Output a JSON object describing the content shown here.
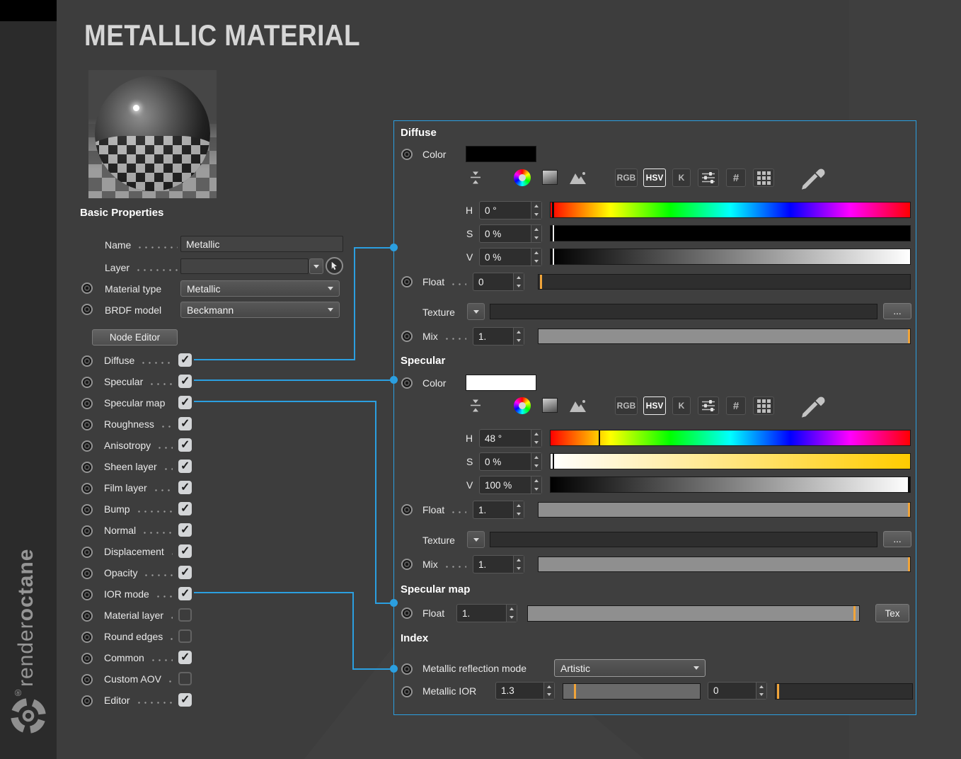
{
  "colors": {
    "accent_blue": "#2b9fe0",
    "slider_marker_orange": "#f0a43a",
    "diffuse_swatch": "#000000",
    "specular_swatch": "#ffffff"
  },
  "sidebar": {
    "brand_bold": "octane",
    "brand_light": "render",
    "registered": "®"
  },
  "header": {
    "title": "METALLIC MATERIAL"
  },
  "basic": {
    "heading": "Basic Properties",
    "name_label": "Name",
    "name_value": "Metallic",
    "layer_label": "Layer",
    "layer_value": "",
    "material_type_label": "Material type",
    "material_type_value": "Metallic",
    "brdf_label": "BRDF model",
    "brdf_value": "Beckmann",
    "node_editor": "Node Editor",
    "toggles": [
      {
        "label": "Diffuse",
        "checked": true
      },
      {
        "label": "Specular",
        "checked": true
      },
      {
        "label": "Specular map",
        "checked": true
      },
      {
        "label": "Roughness",
        "checked": true
      },
      {
        "label": "Anisotropy",
        "checked": true
      },
      {
        "label": "Sheen layer",
        "checked": true
      },
      {
        "label": "Film layer",
        "checked": true
      },
      {
        "label": "Bump",
        "checked": true
      },
      {
        "label": "Normal",
        "checked": true
      },
      {
        "label": "Displacement",
        "checked": true
      },
      {
        "label": "Opacity",
        "checked": true
      },
      {
        "label": "IOR mode",
        "checked": true
      },
      {
        "label": "Material layer",
        "checked": false
      },
      {
        "label": "Round edges",
        "checked": false
      },
      {
        "label": "Common",
        "checked": true
      },
      {
        "label": "Custom AOV",
        "checked": false
      },
      {
        "label": "Editor",
        "checked": true
      }
    ]
  },
  "panel": {
    "toolbar": {
      "rgb": "RGB",
      "hsv": "HSV",
      "k": "K",
      "hash": "#"
    },
    "diffuse": {
      "heading": "Diffuse",
      "color_label": "Color",
      "swatch": "#000000",
      "h_label": "H",
      "h_value": "0 °",
      "h_marker": 0.4,
      "s_label": "S",
      "s_value": "0 %",
      "s_marker": 0.5,
      "v_label": "V",
      "v_value": "0 %",
      "v_marker": 0.5,
      "float_label": "Float",
      "float_value": "0",
      "float_fill": 0,
      "float_marker": 0.3,
      "texture_label": "Texture",
      "browse": "...",
      "mix_label": "Mix",
      "mix_value": "1.",
      "mix_fill": 100,
      "mix_marker": 99.4
    },
    "specular": {
      "heading": "Specular",
      "color_label": "Color",
      "swatch": "#ffffff",
      "h_label": "H",
      "h_value": "48 °",
      "h_marker": 13.3,
      "s_label": "S",
      "s_value": "0 %",
      "s_marker": 0.5,
      "v_label": "V",
      "v_value": "100 %",
      "v_marker": 99.5,
      "float_label": "Float",
      "float_value": "1.",
      "float_fill": 100,
      "float_marker": 99.4,
      "texture_label": "Texture",
      "browse": "...",
      "mix_label": "Mix",
      "mix_value": "1.",
      "mix_fill": 100,
      "mix_marker": 99.4
    },
    "specular_map": {
      "heading": "Specular map",
      "float_label": "Float",
      "float_value": "1.",
      "float_fill": 100,
      "float_marker": 98.2,
      "tex_button": "Tex"
    },
    "index": {
      "heading": "Index",
      "mode_label": "Metallic reflection mode",
      "mode_value": "Artistic",
      "ior_label": "Metallic IOR",
      "ior_value": "1.3",
      "ior_marker": 8,
      "ior2_value": "0",
      "ior2_marker": 1
    }
  }
}
